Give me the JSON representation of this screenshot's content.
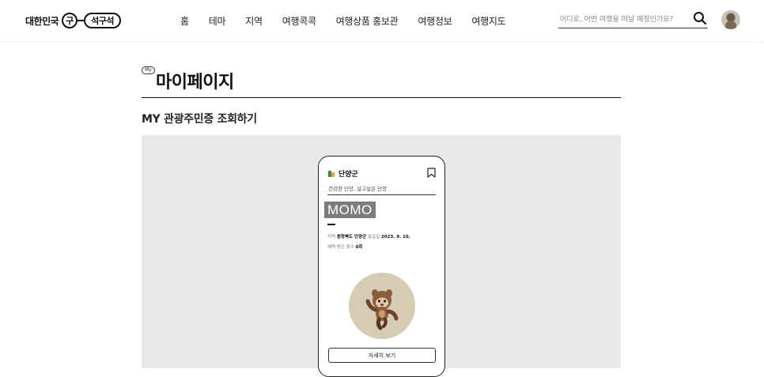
{
  "header": {
    "logo_text": "대한민국",
    "logo_circle": "구",
    "logo_pill": "석구석",
    "nav": [
      "홈",
      "테마",
      "지역",
      "여행콕콕",
      "여행상품 홍보관",
      "여행정보",
      "여행지도"
    ],
    "search_placeholder": "어디로, 어떤 여행을 떠날 예정인가요?",
    "search_icon": "search-icon",
    "avatar_icon": "user-avatar"
  },
  "page": {
    "badge": "My",
    "title": "마이페이지",
    "section_title": "MY 관광주민증 조회하기"
  },
  "card": {
    "region_icon": "region-logo-icon",
    "region": "단양군",
    "slogan": "건강한 단양, 살고싶은 단양",
    "nickname": "MOMO",
    "region_label": "지역",
    "region_value": "충청북도 단양군",
    "issued_label": "발급일",
    "issued_value": "2023. 9. 10.",
    "benefit_label": "혜택 받은 횟수",
    "benefit_value": "0회",
    "detail_button": "자세히 보기",
    "bookmark_icon": "bookmark-icon",
    "mascot_icon": "mascot-character"
  },
  "colors": {
    "panel_bg": "#e9e9e9",
    "nickname_bg": "#7c7c7c",
    "mascot_circle": "#d6ccb5",
    "mascot_body": "#8a5e3c"
  }
}
